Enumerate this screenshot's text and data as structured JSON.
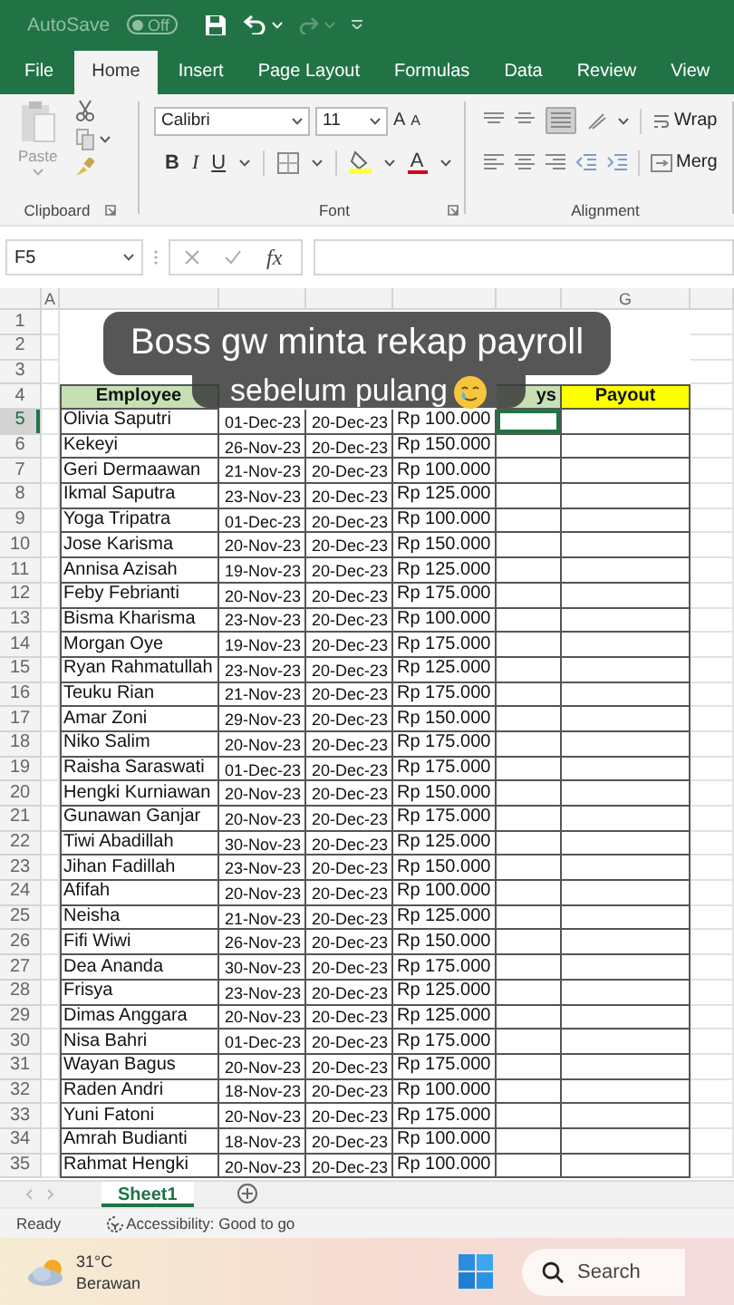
{
  "title_bar": {
    "autosave_label": "AutoSave",
    "autosave": {
      "label": "Off",
      "on": false
    }
  },
  "ribbon_tabs": [
    {
      "label": "File",
      "selected": false
    },
    {
      "label": "Home",
      "selected": true
    },
    {
      "label": "Insert",
      "selected": false
    },
    {
      "label": "Page Layout",
      "selected": false
    },
    {
      "label": "Formulas",
      "selected": false
    },
    {
      "label": "Data",
      "selected": false
    },
    {
      "label": "Review",
      "selected": false
    },
    {
      "label": "View",
      "selected": false
    }
  ],
  "ribbon": {
    "paste": "Paste",
    "clipboard_label": "Clipboard",
    "font_name": "Calibri",
    "font_size": "11",
    "grow_font": "A",
    "shrink_font": "A",
    "bold": "B",
    "italic": "I",
    "underline": "U",
    "font_color": "A",
    "font_label": "Font",
    "bottom_align_on": true,
    "wrap_text": "Wrap",
    "merge": "Merg",
    "alignment_label": "Alignment"
  },
  "formula_bar": {
    "name_box": "F5",
    "fx": "fx"
  },
  "sheet": {
    "column_headers": [
      "A",
      "G"
    ],
    "row_numbers": [
      "1",
      "2",
      "3",
      "4",
      "5",
      "6",
      "7",
      "8",
      "9",
      "10",
      "11",
      "12",
      "13",
      "14",
      "15",
      "16",
      "17",
      "18",
      "19",
      "20",
      "21",
      "22",
      "23",
      "24",
      "25",
      "26",
      "27",
      "28",
      "29",
      "30",
      "31",
      "32",
      "33",
      "34",
      "35"
    ],
    "header_row": [
      {
        "label": "Employee",
        "color": "#c6e0b4"
      },
      {
        "label": "ys",
        "color": "#c6e0b4"
      },
      {
        "label": "Payout",
        "color": "#ffff00"
      }
    ],
    "rows": [
      {
        "name": "Olivia Saputri",
        "start": "01-Dec-23",
        "end": "20-Dec-23",
        "rate": "Rp 100.000",
        "selected": true
      },
      {
        "name": "Kekeyi",
        "start": "26-Nov-23",
        "end": "20-Dec-23",
        "rate": "Rp 150.000",
        "selected": false
      },
      {
        "name": "Geri Dermaawan",
        "start": "21-Nov-23",
        "end": "20-Dec-23",
        "rate": "Rp 100.000",
        "selected": false
      },
      {
        "name": "Ikmal Saputra",
        "start": "23-Nov-23",
        "end": "20-Dec-23",
        "rate": "Rp 125.000",
        "selected": false
      },
      {
        "name": "Yoga Tripatra",
        "start": "01-Dec-23",
        "end": "20-Dec-23",
        "rate": "Rp 100.000",
        "selected": false
      },
      {
        "name": "Jose Karisma",
        "start": "20-Nov-23",
        "end": "20-Dec-23",
        "rate": "Rp 150.000",
        "selected": false
      },
      {
        "name": "Annisa Azisah",
        "start": "19-Nov-23",
        "end": "20-Dec-23",
        "rate": "Rp 125.000",
        "selected": false
      },
      {
        "name": "Feby Febrianti",
        "start": "20-Nov-23",
        "end": "20-Dec-23",
        "rate": "Rp 175.000",
        "selected": false
      },
      {
        "name": "Bisma Kharisma",
        "start": "23-Nov-23",
        "end": "20-Dec-23",
        "rate": "Rp 100.000",
        "selected": false
      },
      {
        "name": "Morgan Oye",
        "start": "19-Nov-23",
        "end": "20-Dec-23",
        "rate": "Rp 175.000",
        "selected": false
      },
      {
        "name": "Ryan Rahmatullah",
        "start": "23-Nov-23",
        "end": "20-Dec-23",
        "rate": "Rp 125.000",
        "selected": false
      },
      {
        "name": "Teuku Rian",
        "start": "21-Nov-23",
        "end": "20-Dec-23",
        "rate": "Rp 175.000",
        "selected": false
      },
      {
        "name": "Amar Zoni",
        "start": "29-Nov-23",
        "end": "20-Dec-23",
        "rate": "Rp 150.000",
        "selected": false
      },
      {
        "name": "Niko Salim",
        "start": "20-Nov-23",
        "end": "20-Dec-23",
        "rate": "Rp 175.000",
        "selected": false
      },
      {
        "name": "Raisha Saraswati",
        "start": "01-Dec-23",
        "end": "20-Dec-23",
        "rate": "Rp 175.000",
        "selected": false
      },
      {
        "name": "Hengki Kurniawan",
        "start": "20-Nov-23",
        "end": "20-Dec-23",
        "rate": "Rp 150.000",
        "selected": false
      },
      {
        "name": "Gunawan Ganjar",
        "start": "20-Nov-23",
        "end": "20-Dec-23",
        "rate": "Rp 175.000",
        "selected": false
      },
      {
        "name": "Tiwi Abadillah",
        "start": "30-Nov-23",
        "end": "20-Dec-23",
        "rate": "Rp 125.000",
        "selected": false
      },
      {
        "name": "Jihan Fadillah",
        "start": "23-Nov-23",
        "end": "20-Dec-23",
        "rate": "Rp 150.000",
        "selected": false
      },
      {
        "name": "Afifah",
        "start": "20-Nov-23",
        "end": "20-Dec-23",
        "rate": "Rp 100.000",
        "selected": false
      },
      {
        "name": "Neisha",
        "start": "21-Nov-23",
        "end": "20-Dec-23",
        "rate": "Rp 125.000",
        "selected": false
      },
      {
        "name": "Fifi Wiwi",
        "start": "26-Nov-23",
        "end": "20-Dec-23",
        "rate": "Rp 150.000",
        "selected": false
      },
      {
        "name": "Dea Ananda",
        "start": "30-Nov-23",
        "end": "20-Dec-23",
        "rate": "Rp 175.000",
        "selected": false
      },
      {
        "name": "Frisya",
        "start": "23-Nov-23",
        "end": "20-Dec-23",
        "rate": "Rp 125.000",
        "selected": false
      },
      {
        "name": "Dimas Anggara",
        "start": "20-Nov-23",
        "end": "20-Dec-23",
        "rate": "Rp 125.000",
        "selected": false
      },
      {
        "name": "Nisa Bahri",
        "start": "01-Dec-23",
        "end": "20-Dec-23",
        "rate": "Rp 175.000",
        "selected": false
      },
      {
        "name": "Wayan Bagus",
        "start": "20-Nov-23",
        "end": "20-Dec-23",
        "rate": "Rp 175.000",
        "selected": false
      },
      {
        "name": "Raden Andri",
        "start": "18-Nov-23",
        "end": "20-Dec-23",
        "rate": "Rp 100.000",
        "selected": false
      },
      {
        "name": "Yuni Fatoni",
        "start": "20-Nov-23",
        "end": "20-Dec-23",
        "rate": "Rp 175.000",
        "selected": false
      },
      {
        "name": "Amrah Budianti",
        "start": "18-Nov-23",
        "end": "20-Dec-23",
        "rate": "Rp 100.000",
        "selected": false
      },
      {
        "name": "Rahmat Hengki",
        "start": "20-Nov-23",
        "end": "20-Dec-23",
        "rate": "Rp 100.000",
        "selected": false
      }
    ]
  },
  "caption": {
    "lines": [
      "Boss gw minta rekap payroll",
      "sebelum pulang"
    ]
  },
  "sheet_tabs": [
    {
      "label": "Sheet1",
      "selected": true
    }
  ],
  "status_bar": {
    "mode": "Ready",
    "accessibility": "Accessibility: Good to go"
  },
  "taskbar": {
    "temperature": "31°C",
    "weather": "Berawan",
    "search": "Search"
  }
}
